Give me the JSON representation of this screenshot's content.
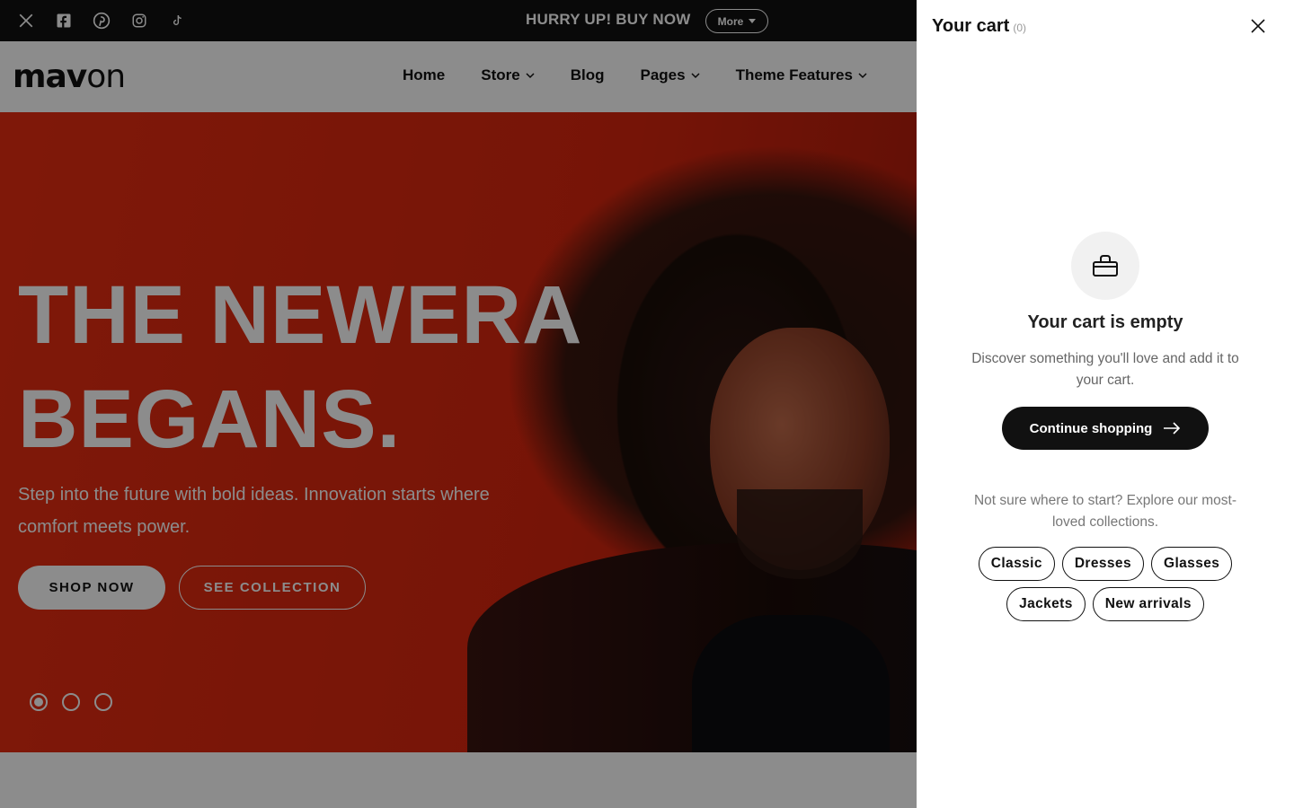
{
  "announcement": {
    "social_icons": [
      "x-icon",
      "facebook-icon",
      "pinterest-icon",
      "instagram-icon",
      "tiktok-icon"
    ],
    "message": "HURRY UP! BUY NOW",
    "more_label": "More"
  },
  "header": {
    "logo_bold": "mav",
    "logo_light": "on",
    "nav": [
      {
        "label": "Home",
        "has_dropdown": false
      },
      {
        "label": "Store",
        "has_dropdown": true
      },
      {
        "label": "Blog",
        "has_dropdown": false
      },
      {
        "label": "Pages",
        "has_dropdown": true
      },
      {
        "label": "Theme Features",
        "has_dropdown": true
      }
    ]
  },
  "hero": {
    "title_line1": "THE NEWERA",
    "title_line2": "BEGANS.",
    "subtitle": "Step into the future with bold ideas. Innovation starts where comfort meets power.",
    "primary_button": "SHOP NOW",
    "secondary_button": "SEE COLLECTION",
    "slides_total": 3,
    "active_slide": 1
  },
  "cart": {
    "title": "Your cart",
    "count": "(0)",
    "empty_title": "Your cart is empty",
    "empty_description": "Discover something you'll love and add it to your cart.",
    "continue_label": "Continue shopping",
    "explore_text": "Not sure where to start? Explore our most-loved collections.",
    "collections": [
      "Classic",
      "Dresses",
      "Glasses",
      "Jackets",
      "New arrivals"
    ]
  },
  "colors": {
    "accent": "#111111",
    "hero_red": "#d8260e",
    "overlay": "rgba(0,0,0,0.45)"
  }
}
